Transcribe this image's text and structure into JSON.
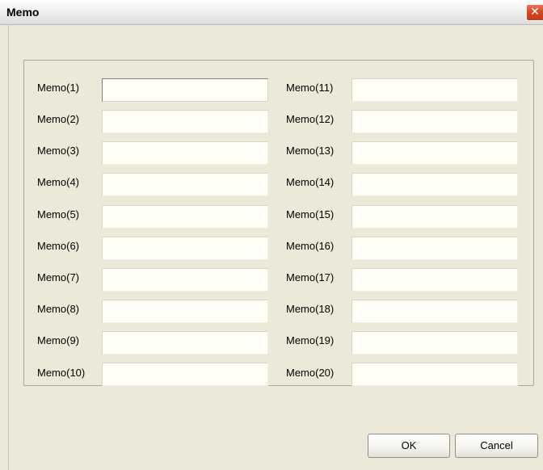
{
  "window": {
    "title": "Memo",
    "close_glyph": "✕",
    "close_icon": "close-icon"
  },
  "memos": [
    {
      "label": "Memo(1)",
      "value": ""
    },
    {
      "label": "Memo(2)",
      "value": ""
    },
    {
      "label": "Memo(3)",
      "value": ""
    },
    {
      "label": "Memo(4)",
      "value": ""
    },
    {
      "label": "Memo(5)",
      "value": ""
    },
    {
      "label": "Memo(6)",
      "value": ""
    },
    {
      "label": "Memo(7)",
      "value": ""
    },
    {
      "label": "Memo(8)",
      "value": ""
    },
    {
      "label": "Memo(9)",
      "value": ""
    },
    {
      "label": "Memo(10)",
      "value": ""
    },
    {
      "label": "Memo(11)",
      "value": ""
    },
    {
      "label": "Memo(12)",
      "value": ""
    },
    {
      "label": "Memo(13)",
      "value": ""
    },
    {
      "label": "Memo(14)",
      "value": ""
    },
    {
      "label": "Memo(15)",
      "value": ""
    },
    {
      "label": "Memo(16)",
      "value": ""
    },
    {
      "label": "Memo(17)",
      "value": ""
    },
    {
      "label": "Memo(18)",
      "value": ""
    },
    {
      "label": "Memo(19)",
      "value": ""
    },
    {
      "label": "Memo(20)",
      "value": ""
    }
  ],
  "buttons": {
    "ok_label": "OK",
    "cancel_label": "Cancel"
  },
  "colors": {
    "dialog_background": "#ece9d8",
    "close_button": "#d2461f",
    "input_background": "#fffff8"
  }
}
